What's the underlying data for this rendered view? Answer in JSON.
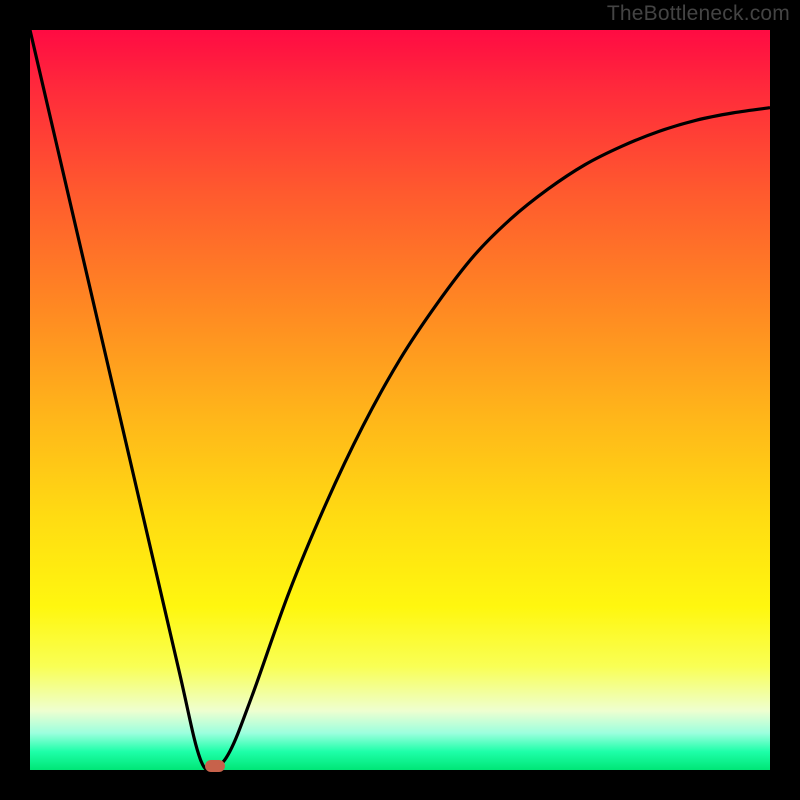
{
  "watermark": "TheBottleneck.com",
  "colors": {
    "bg": "#000000",
    "gradient_top": "#ff0b43",
    "gradient_mid": "#ffdc12",
    "gradient_bottom": "#00e676",
    "curve": "#000000",
    "marker": "#c7624b"
  },
  "chart_data": {
    "type": "line",
    "title": "",
    "xlabel": "",
    "ylabel": "",
    "xlim": [
      0,
      100
    ],
    "ylim": [
      0,
      100
    ],
    "grid": false,
    "legend": false,
    "series": [
      {
        "name": "bottleneck-curve",
        "x": [
          0,
          5,
          10,
          15,
          20,
          23,
          25,
          27,
          30,
          35,
          40,
          45,
          50,
          55,
          60,
          65,
          70,
          75,
          80,
          85,
          90,
          95,
          100
        ],
        "y": [
          100,
          78.5,
          57,
          35.5,
          14,
          1.5,
          0.5,
          2.5,
          10,
          24,
          36,
          46.5,
          55.5,
          63,
          69.5,
          74.5,
          78.5,
          81.8,
          84.3,
          86.3,
          87.8,
          88.8,
          89.5
        ]
      }
    ],
    "annotations": [
      {
        "name": "minimum-marker",
        "x": 25,
        "y": 0.5
      }
    ]
  }
}
